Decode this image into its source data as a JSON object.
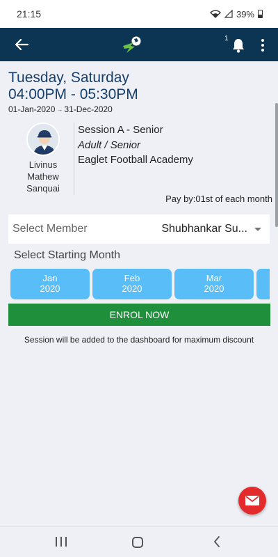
{
  "status_bar": {
    "time": "21:15",
    "battery": "39%"
  },
  "header": {
    "notification_count": "1"
  },
  "session": {
    "days": "Tuesday, Saturday",
    "time_range": "04:00PM - 05:30PM",
    "start_date": "01-Jan-2020",
    "end_date": "31-Dec-2020",
    "coach": {
      "first": "Livinus",
      "middle": "Mathew",
      "last": "Sanquai"
    },
    "name": "Session A - Senior",
    "level": "Adult / Senior",
    "academy": "Eaglet Football Academy",
    "pay_by": "Pay by:01st of each month"
  },
  "member_select": {
    "label": "Select Member",
    "value": "Shubhankar Su..."
  },
  "start_month": {
    "label": "Select Starting Month",
    "months": [
      {
        "month": "Jan",
        "year": "2020"
      },
      {
        "month": "Feb",
        "year": "2020"
      },
      {
        "month": "Mar",
        "year": "2020"
      }
    ]
  },
  "enrol_button": "ENROL NOW",
  "notice": "Session will be added to the dashboard for maximum discount",
  "colors": {
    "app_bar": "#0b3552",
    "month_button": "#59bdf7",
    "enrol": "#1f8f3c",
    "fab": "#e32b2b",
    "heading": "#163f6b"
  },
  "icons": [
    "back-arrow-icon",
    "app-logo-icon",
    "bell-icon",
    "more-vert-icon",
    "mail-icon",
    "nav-recent-icon",
    "nav-home-icon",
    "nav-back-icon"
  ]
}
